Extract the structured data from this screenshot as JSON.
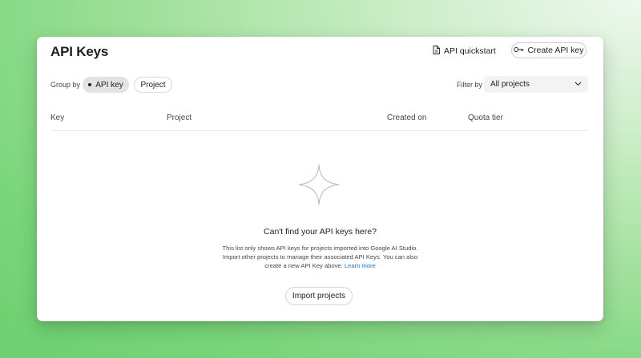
{
  "header": {
    "title": "API Keys",
    "quickstart_label": "API quickstart",
    "quickstart_icon": "document-icon",
    "create_label": "Create API key",
    "create_icon": "key-icon"
  },
  "toolbar": {
    "group_by_label": "Group by",
    "group_options": [
      {
        "label": "API key",
        "selected": true
      },
      {
        "label": "Project",
        "selected": false
      }
    ],
    "filter_by_label": "Filter by",
    "filter_value": "All projects"
  },
  "table": {
    "columns": [
      "Key",
      "Project",
      "Created on",
      "Quota tier"
    ],
    "rows": []
  },
  "empty_state": {
    "icon": "sparkle-icon",
    "title": "Can't find your API keys here?",
    "description_line1": "This list only shows API keys for projects imported into Google AI Studio.",
    "description_line2": "Import other projects to manage their associated API Keys. You can also",
    "description_line3_prefix": "create a new API Key above.",
    "learn_more_label": "Learn more",
    "import_button_label": "Import projects"
  },
  "colors": {
    "background_green": "#6ccf70",
    "link_blue": "#1a73e8",
    "selected_chip": "#e3e3e3"
  }
}
